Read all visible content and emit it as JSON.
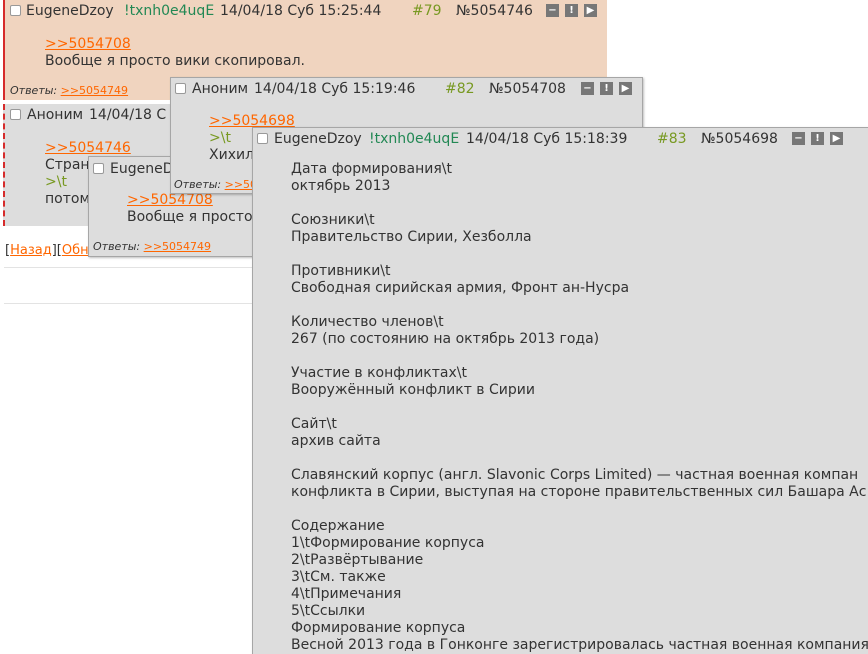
{
  "post79": {
    "name": "EugeneDzoy",
    "trip": "!txnh0e4uqE",
    "time": "14/04/18 Суб 15:25:44",
    "num": "#79",
    "no": "№5054746",
    "link": ">>5054708",
    "text": "Вообще я просто вики скопировал.",
    "replies_label": "Ответы:",
    "reply": ">>5054749"
  },
  "post_anon_bg": {
    "name": "Аноним",
    "time": "14/04/18 С",
    "link": ">>5054746",
    "line1": "Стран",
    "line2": ">\\t",
    "line3": "потом"
  },
  "popup_eug": {
    "name": "EugeneD",
    "link": ">>5054708",
    "text": "Вообще я просто",
    "replies_label": "Ответы:",
    "reply": ">>5054749"
  },
  "popup82": {
    "name": "Аноним",
    "time": "14/04/18 Суб 15:19:46",
    "num": "#82",
    "no": "№5054708",
    "link": ">>5054698",
    "line1": ">\\t",
    "line2": "Хихил",
    "replies_label": "Ответы:",
    "reply": ">>50"
  },
  "nav": {
    "back": "Назад",
    "update": "Обн"
  },
  "popup83": {
    "name": "EugeneDzoy",
    "trip": "!txnh0e4uqE",
    "time": "14/04/18 Суб 15:18:39",
    "num": "#83",
    "no": "№5054698",
    "lines": [
      "Дата формирования\\t",
      "октябрь 2013",
      "",
      "Союзники\\t",
      "Правительство Сирии, Хезболла",
      "",
      "Противники\\t",
      "Свободная сирийская армия, Фронт ан-Нусра",
      "",
      "Количество членов\\t",
      "267 (по состоянию на октябрь 2013 года)",
      "",
      "Участие в конфликтах\\t",
      "Вооружённый конфликт в Сирии",
      "",
      "Сайт\\t",
      "архив сайта",
      "",
      "Славянский корпус (англ. Slavonic Corps Limited) — частная военная компан",
      "конфликта в Сирии, выступая на стороне правительственных сил Башара Ас",
      "",
      "Содержание",
      "1\\tФормирование корпуса",
      "2\\tРазвёртывание",
      "3\\tСм. также",
      "4\\tПримечания",
      "5\\tСсылки",
      "Формирование корпуса",
      "Весной 2013 года в Гонконге зарегистрировалась частная военная компания"
    ]
  },
  "icons": {
    "minus": "−",
    "excl": "!",
    "play": "▶"
  }
}
